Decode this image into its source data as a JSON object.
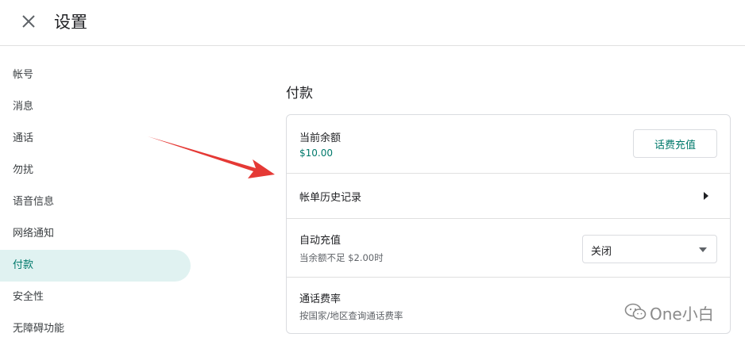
{
  "header": {
    "title": "设置",
    "close_icon": "close-icon"
  },
  "sidebar": {
    "items": [
      {
        "label": "帐号"
      },
      {
        "label": "消息"
      },
      {
        "label": "通话"
      },
      {
        "label": "勿扰"
      },
      {
        "label": "语音信息"
      },
      {
        "label": "网络通知"
      },
      {
        "label": "付款",
        "active": true
      },
      {
        "label": "安全性"
      },
      {
        "label": "无障碍功能"
      }
    ]
  },
  "payment": {
    "title": "付款",
    "balance": {
      "label": "当前余额",
      "value": "$10.00",
      "button": "话费充值"
    },
    "billing": {
      "label": "帐单历史记录"
    },
    "auto_topup": {
      "label": "自动充值",
      "sub": "当余额不足 $2.00时",
      "selected": "关闭"
    },
    "rates": {
      "label": "通话费率",
      "sub": "按国家/地区查询通话费率"
    }
  },
  "watermark": {
    "text": "One小白"
  },
  "colors": {
    "accent": "#00796b",
    "active_bg": "#e0f2f1",
    "arrow": "#e53935"
  }
}
